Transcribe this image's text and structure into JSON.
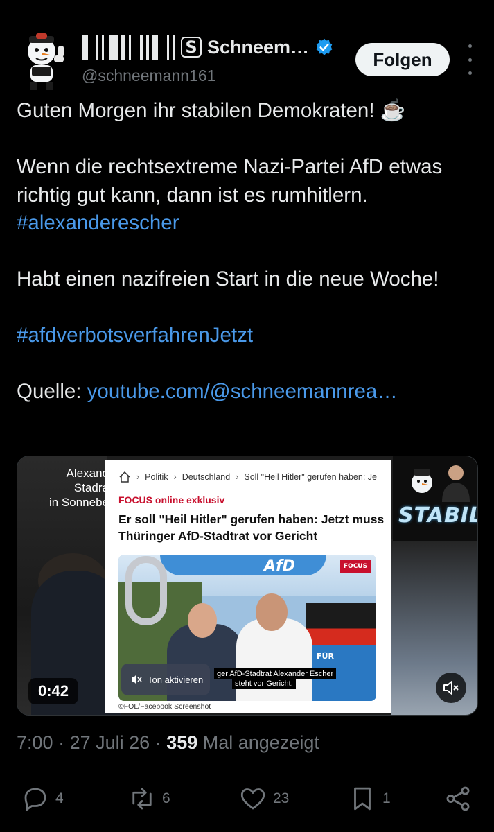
{
  "author": {
    "display_name": "Schneem…",
    "display_name_badge": "S",
    "handle": "@schneemann161",
    "verified": true,
    "avatar_icon": "snowman-avatar-icon"
  },
  "follow_button": {
    "label": "Folgen"
  },
  "tweet": {
    "line1": "Guten Morgen ihr stabilen Demokraten! ☕",
    "para2": "Wenn die rechtsextreme Nazi-Partei AfD etwas richtig gut kann, dann ist es rumhitlern. ",
    "hashtag1": "#alexanderescher",
    "para3": "Habt einen nazifreien Start in die neue Woche!",
    "hashtag2": "#afdverbotsverfahrenJetzt",
    "source_label": "Quelle: ",
    "source_link": "youtube.com/@schneemannrea…"
  },
  "media": {
    "side_caption_lines": [
      "Alexand",
      "Stadra",
      "in Sonnebe"
    ],
    "stabil_word": "STABIL",
    "article": {
      "breadcrumb": [
        "Politik",
        "Deutschland",
        "Soll \"Heil Hitler\" gerufen haben: Je"
      ],
      "tag": "FOCUS online exklusiv",
      "headline": "Er soll \"Heil Hitler\" gerufen haben: Jetzt muss Thüringer AfD-Stadtrat vor Gericht",
      "photo_brand": "AfD",
      "photo_banner_text": "FÜR",
      "logo_text": "FOCUS",
      "photo_caption_1": "ger AfD-Stadtrat Alexander Escher",
      "photo_caption_2": "steht vor Gericht.",
      "credit": "©FOL/Facebook Screenshot"
    },
    "unmute_label": "Ton aktivieren",
    "duration": "0:42"
  },
  "meta": {
    "time": "7:00",
    "date": "27 Juli 26",
    "views": "359",
    "views_label": " Mal angezeigt"
  },
  "actions": {
    "replies": "4",
    "reposts": "6",
    "likes": "23",
    "bookmarks": "1"
  },
  "colors": {
    "background": "#000000",
    "text": "#e7e9ea",
    "muted": "#71767b",
    "link": "#4a99e9",
    "verified": "#1d9bf0"
  }
}
